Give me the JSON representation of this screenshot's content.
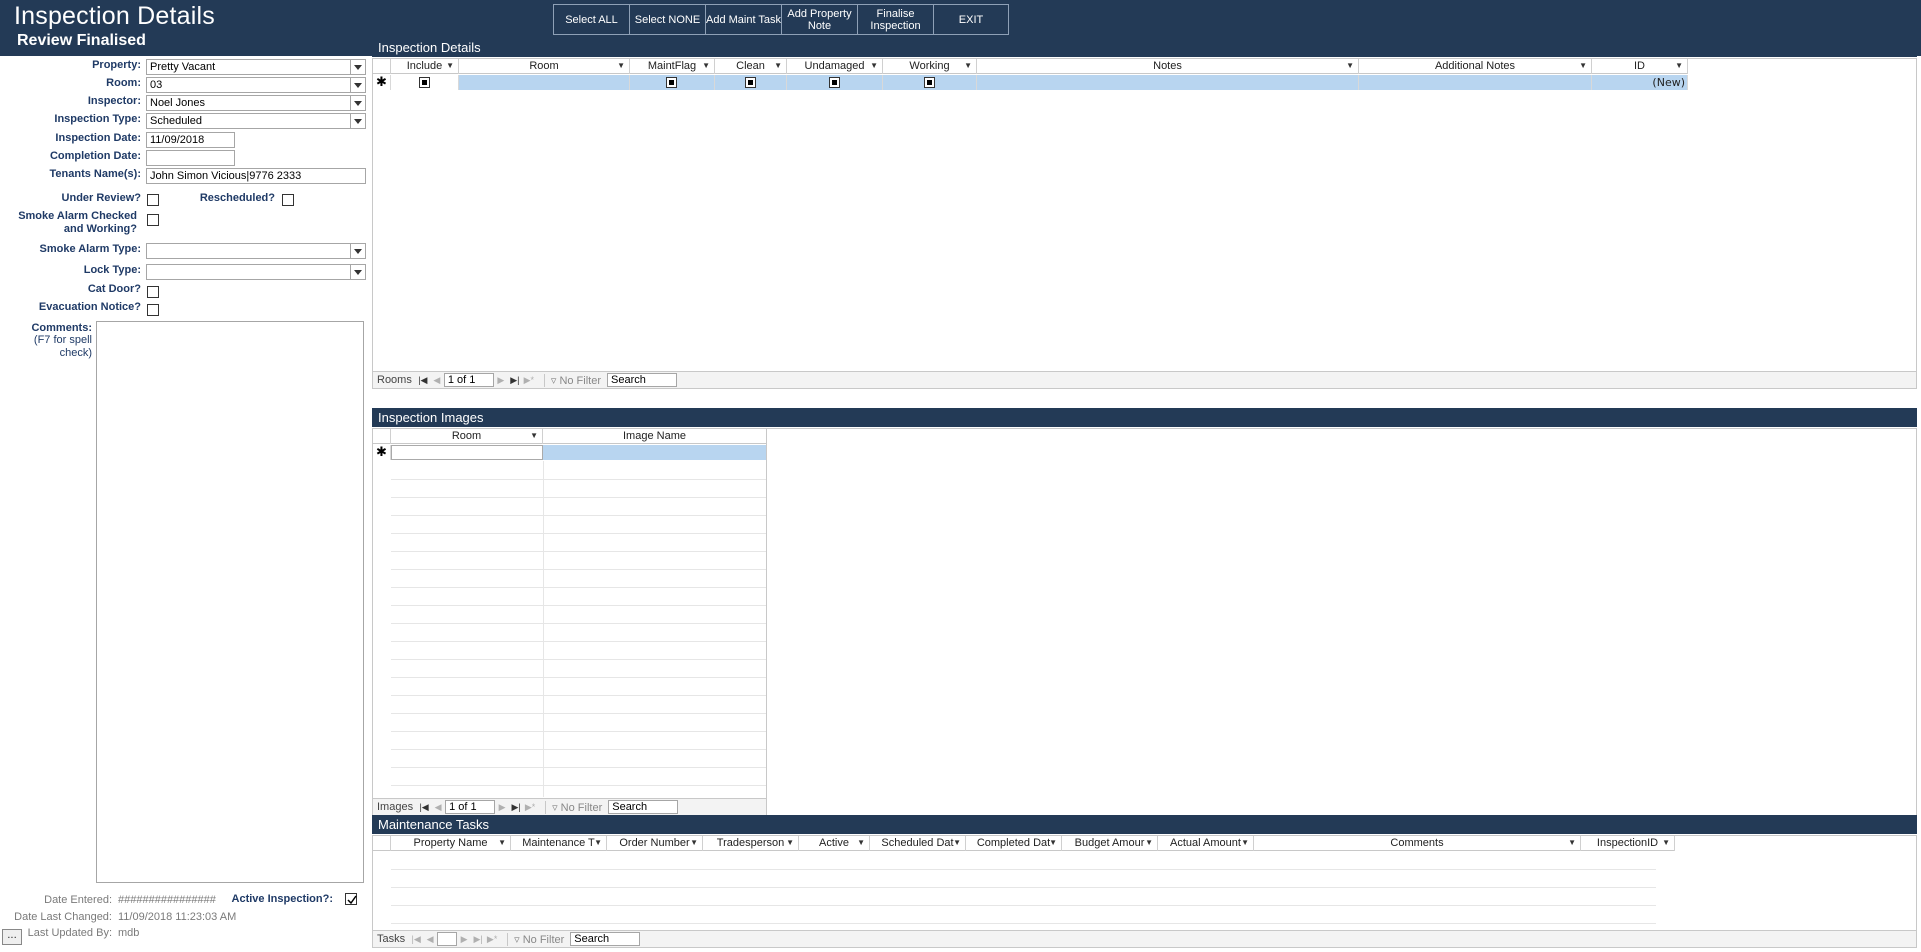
{
  "header": {
    "title": "Inspection Details",
    "subtitle": "Review Finalised"
  },
  "toolbar": {
    "select_all": "Select ALL",
    "select_none": "Select NONE",
    "add_maint_task": "Add Maint Task",
    "add_property_note": "Add Property Note",
    "finalise_inspection": "Finalise Inspection",
    "exit": "EXIT"
  },
  "form": {
    "property_label": "Property:",
    "property_value": "Pretty Vacant",
    "room_label": "Room:",
    "room_value": "03",
    "inspector_label": "Inspector:",
    "inspector_value": "Noel Jones",
    "inspection_type_label": "Inspection Type:",
    "inspection_type_value": "Scheduled",
    "inspection_date_label": "Inspection Date:",
    "inspection_date_value": "11/09/2018",
    "completion_date_label": "Completion Date:",
    "completion_date_value": "",
    "tenants_label": "Tenants Name(s):",
    "tenants_value": "John Simon Vicious|9776 2333",
    "under_review_label": "Under Review?",
    "rescheduled_label": "Rescheduled?",
    "smoke_checked_label_1": "Smoke Alarm Checked",
    "smoke_checked_label_2": "and Working?",
    "smoke_type_label": "Smoke Alarm Type:",
    "smoke_type_value": "",
    "lock_type_label": "Lock Type:",
    "lock_type_value": "",
    "cat_door_label": "Cat Door?",
    "evacuation_label": "Evacuation Notice?",
    "comments_label": "Comments:",
    "comments_hint_1": "(F7 for spell",
    "comments_hint_2": "check)",
    "comments_value": ""
  },
  "footer": {
    "date_entered_label": "Date Entered:",
    "date_entered_value": "################",
    "active_inspection_label": "Active Inspection?:",
    "active_inspection_checked": true,
    "date_last_changed_label": "Date Last Changed:",
    "date_last_changed_value": "11/09/2018 11:23:03 AM",
    "last_updated_by_label": "Last Updated By:",
    "last_updated_by_value": "mdb",
    "corner_button": "..."
  },
  "rooms_section": {
    "title": "Inspection Details",
    "columns": [
      "Include",
      "Room",
      "MaintFlag",
      "Clean",
      "Undamaged",
      "Working",
      "Notes",
      "Additional Notes",
      "ID"
    ],
    "new_row_id": "(New)",
    "nav_label": "Rooms",
    "record": "1 of 1",
    "no_filter": "No Filter",
    "search": "Search"
  },
  "images_section": {
    "title": "Inspection Images",
    "columns": [
      "Room",
      "Image Name"
    ],
    "nav_label": "Images",
    "record": "1 of 1",
    "no_filter": "No Filter",
    "search": "Search"
  },
  "tasks_section": {
    "title": "Maintenance Tasks",
    "columns": [
      "Property Name",
      "Maintenance T",
      "Order Number",
      "Tradesperson",
      "Active",
      "Scheduled Dat",
      "Completed Dat",
      "Budget Amour",
      "Actual Amount",
      "Comments",
      "InspectionID"
    ],
    "nav_label": "Tasks",
    "record": "",
    "no_filter": "No Filter",
    "search": "Search"
  }
}
